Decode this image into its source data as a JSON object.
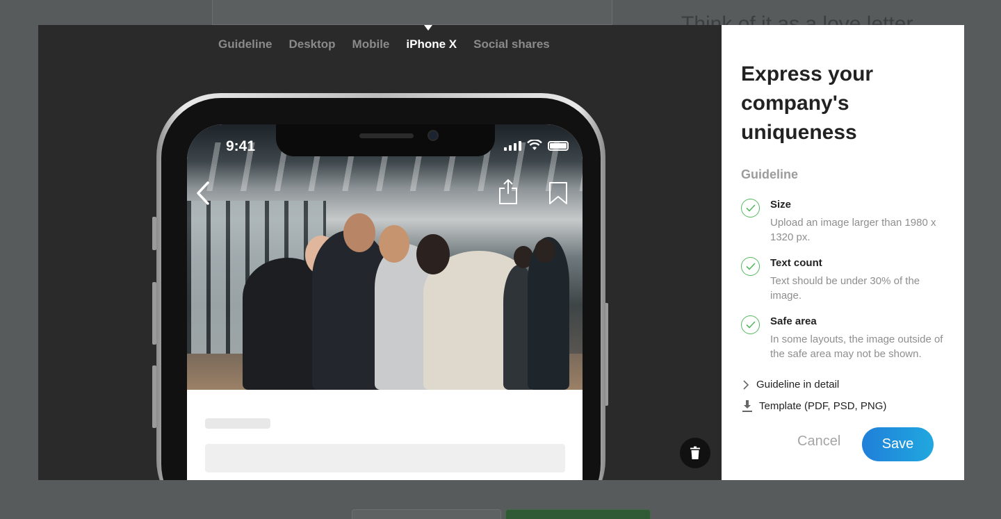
{
  "background": {
    "heading": "Think of it as a love letter"
  },
  "tabs": [
    {
      "label": "Guideline"
    },
    {
      "label": "Desktop"
    },
    {
      "label": "Mobile"
    },
    {
      "label": "iPhone X"
    },
    {
      "label": "Social shares"
    }
  ],
  "active_tab": "iPhone X",
  "phone": {
    "status_time": "9:41"
  },
  "panel": {
    "title": "Express your company's uniqueness",
    "section_label": "Guideline",
    "items": [
      {
        "title": "Size",
        "desc": "Upload an image larger than 1980 x 1320 px."
      },
      {
        "title": "Text count",
        "desc": "Text should be under 30% of the image."
      },
      {
        "title": "Safe area",
        "desc": "In some layouts, the image outside of the safe area may not be shown."
      }
    ],
    "detail_link": "Guideline in detail",
    "template_link": "Template (PDF, PSD, PNG)",
    "cancel_label": "Cancel",
    "save_label": "Save"
  },
  "colors": {
    "accent_start": "#1f7fd9",
    "accent_end": "#21a8df",
    "check_green": "#55b85f"
  }
}
